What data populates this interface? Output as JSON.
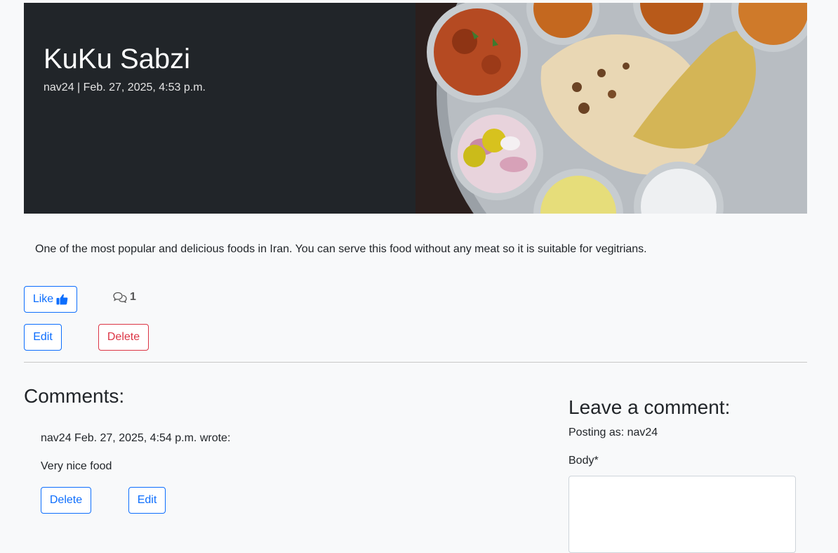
{
  "post": {
    "title": "KuKu Sabzi",
    "meta": "nav24 | Feb. 27, 2025, 4:53 p.m.",
    "body": "One of the most popular and delicious foods in Iran. You can serve this food without any meat so it is suitable for vegitrians.",
    "image_name": "food-platter-image"
  },
  "actions": {
    "like_label": "Like",
    "like_icon": "thumbs-up-icon",
    "comment_icon": "comments-icon",
    "comment_count": "1",
    "edit_label": "Edit",
    "delete_label": "Delete"
  },
  "comments": {
    "heading": "Comments:",
    "items": [
      {
        "author_line": "nav24 Feb. 27, 2025, 4:54 p.m. wrote:",
        "text": "Very nice food",
        "delete_label": "Delete",
        "edit_label": "Edit"
      }
    ]
  },
  "comment_form": {
    "heading": "Leave a comment:",
    "posting_as": "Posting as: nav24",
    "body_label": "Body*",
    "body_value": ""
  },
  "colors": {
    "hero_bg": "#212529",
    "primary": "#0d6efd",
    "danger": "#dc3545",
    "page_bg": "#f8f9fa"
  }
}
